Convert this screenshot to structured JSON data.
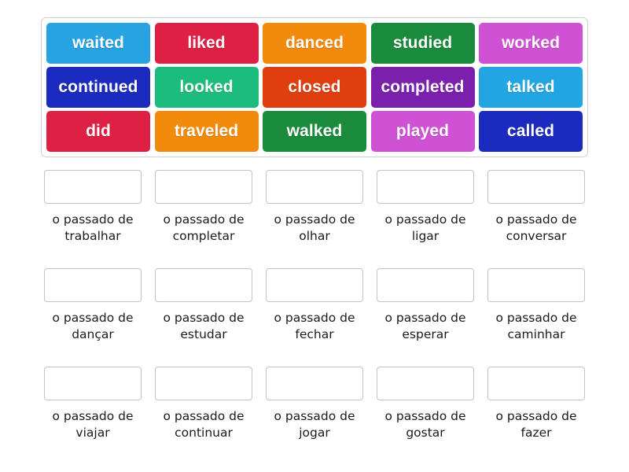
{
  "activity": {
    "type": "match-up",
    "tile_bank": {
      "rows": [
        [
          {
            "label": "waited",
            "color": "#26a3e0"
          },
          {
            "label": "liked",
            "color": "#dd2044"
          },
          {
            "label": "danced",
            "color": "#f28b0c"
          },
          {
            "label": "studied",
            "color": "#1a8a3c"
          },
          {
            "label": "worked",
            "color": "#cf52d4"
          }
        ],
        [
          {
            "label": "continued",
            "color": "#1b2bbf"
          },
          {
            "label": "looked",
            "color": "#1cbc7e"
          },
          {
            "label": "closed",
            "color": "#e03e0f"
          },
          {
            "label": "completed",
            "color": "#7a20ad"
          },
          {
            "label": "talked",
            "color": "#22a6e3"
          }
        ],
        [
          {
            "label": "did",
            "color": "#dd2044"
          },
          {
            "label": "traveled",
            "color": "#f28b0c"
          },
          {
            "label": "walked",
            "color": "#1a8a3c"
          },
          {
            "label": "played",
            "color": "#cf52d4"
          },
          {
            "label": "called",
            "color": "#1b2bbf"
          }
        ]
      ]
    },
    "answers": {
      "rows": [
        [
          {
            "label": "o passado de trabalhar",
            "box_value": ""
          },
          {
            "label": "o passado de completar",
            "box_value": ""
          },
          {
            "label": "o passado de olhar",
            "box_value": ""
          },
          {
            "label": "o passado de ligar",
            "box_value": ""
          },
          {
            "label": "o passado de conversar",
            "box_value": ""
          }
        ],
        [
          {
            "label": "o passado de dançar",
            "box_value": ""
          },
          {
            "label": "o passado de estudar",
            "box_value": ""
          },
          {
            "label": "o passado de fechar",
            "box_value": ""
          },
          {
            "label": "o passado de esperar",
            "box_value": ""
          },
          {
            "label": "o passado de caminhar",
            "box_value": ""
          }
        ],
        [
          {
            "label": "o passado de viajar",
            "box_value": ""
          },
          {
            "label": "o passado de continuar",
            "box_value": ""
          },
          {
            "label": "o passado de jogar",
            "box_value": ""
          },
          {
            "label": "o passado de gostar",
            "box_value": ""
          },
          {
            "label": "o passado de fazer",
            "box_value": ""
          }
        ]
      ]
    }
  }
}
